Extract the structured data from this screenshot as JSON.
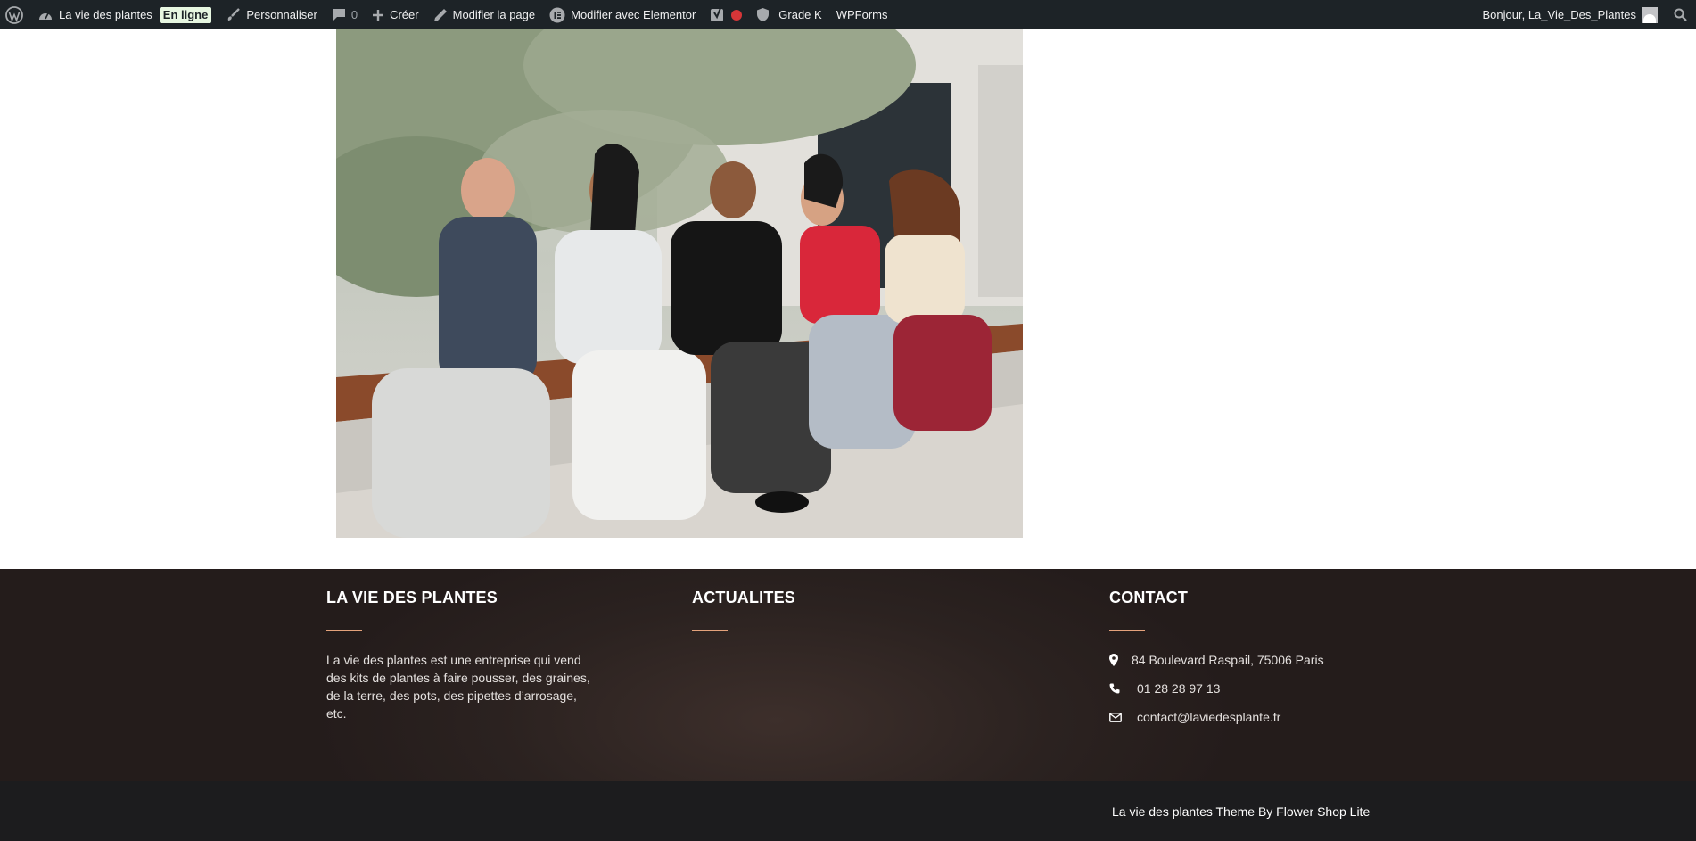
{
  "adminbar": {
    "site_name": "La vie des plantes",
    "status_badge": "En ligne",
    "customize": "Personnaliser",
    "comments_count": "0",
    "new": "Créer",
    "edit_page": "Modifier la page",
    "edit_elementor": "Modifier avec Elementor",
    "grade": "Grade K",
    "wpforms": "WPForms",
    "greeting": "Bonjour, La_Vie_Des_Plantes",
    "colors": {
      "background": "#1d2327",
      "text": "#f0f0f1",
      "notification_dot": "#d63638"
    }
  },
  "footer": {
    "about": {
      "title": "LA VIE DES PLANTES",
      "text": "La vie des plantes est une entreprise qui vend des kits de plantes à faire pousser, des graines, de la terre, des pots, des pipettes d’arrosage, etc."
    },
    "news": {
      "title": "ACTUALITES"
    },
    "contact": {
      "title": "CONTACT",
      "address": "84 Boulevard Raspail, 75006 Paris",
      "phone": "01 28 28 97 13",
      "email": "contact@laviedesplante.fr"
    },
    "accent_color": "#e4a27b",
    "copyright": "La vie des plantes Theme By Flower Shop Lite"
  },
  "icons": [
    "wordpress-icon",
    "dashboard-icon",
    "paintbrush-icon",
    "comment-icon",
    "plus-icon",
    "pencil-icon",
    "elementor-icon",
    "yoast-icon",
    "shield-icon",
    "avatar",
    "search-icon",
    "map-marker-icon",
    "phone-icon",
    "envelope-icon"
  ]
}
